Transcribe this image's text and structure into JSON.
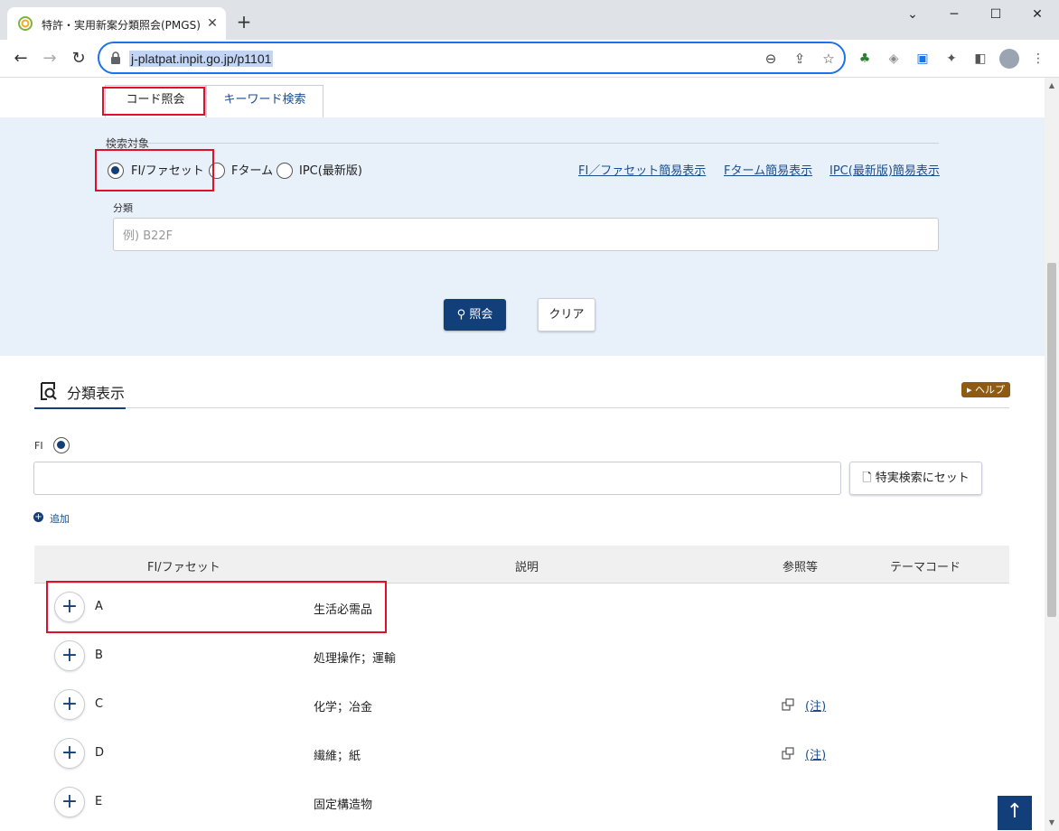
{
  "browser": {
    "tab_title": "特許・実用新案分類照会(PMGS) | J",
    "tab_close": "✕",
    "new_tab": "+",
    "url": "j-platpat.inpit.go.jp/p1101",
    "window_controls": {
      "minimize": "─",
      "maximize": "☐",
      "close": "✕",
      "dropdown": "⌄"
    }
  },
  "search_panel": {
    "tabs": [
      {
        "label": "コード照会"
      },
      {
        "label": "キーワード検索"
      }
    ],
    "target_label": "検索対象",
    "radios": [
      {
        "label": "FI/ファセット",
        "checked": true
      },
      {
        "label": "Fターム",
        "checked": false
      },
      {
        "label": "IPC(最新版)",
        "checked": false
      }
    ],
    "links": [
      "FI／ファセット簡易表示",
      "Fターム簡易表示",
      "IPC(最新版)簡易表示"
    ],
    "classification_label": "分類",
    "classification_placeholder": "例) B22F",
    "search_button": "照会",
    "clear_button": "クリア"
  },
  "results": {
    "section_title": "分類表示",
    "help_label": "▸ ヘルプ",
    "fi_label": "FI",
    "set_button": "特実検索にセット",
    "add_label": "追加",
    "columns": [
      "FI/ファセット",
      "説明",
      "参照等",
      "テーマコード"
    ],
    "rows": [
      {
        "code": "A",
        "desc": "生活必需品",
        "ref": ""
      },
      {
        "code": "B",
        "desc": "処理操作；運輸",
        "ref": ""
      },
      {
        "code": "C",
        "desc": "化学；冶金",
        "ref": "(注)"
      },
      {
        "code": "D",
        "desc": "繊維；紙",
        "ref": "(注)"
      },
      {
        "code": "E",
        "desc": "固定構造物",
        "ref": ""
      }
    ]
  },
  "colors": {
    "primary": "#123e7a",
    "panel_bg": "#e8f1fa",
    "highlight": "#e0102a",
    "help_badge": "#8f5a12"
  }
}
